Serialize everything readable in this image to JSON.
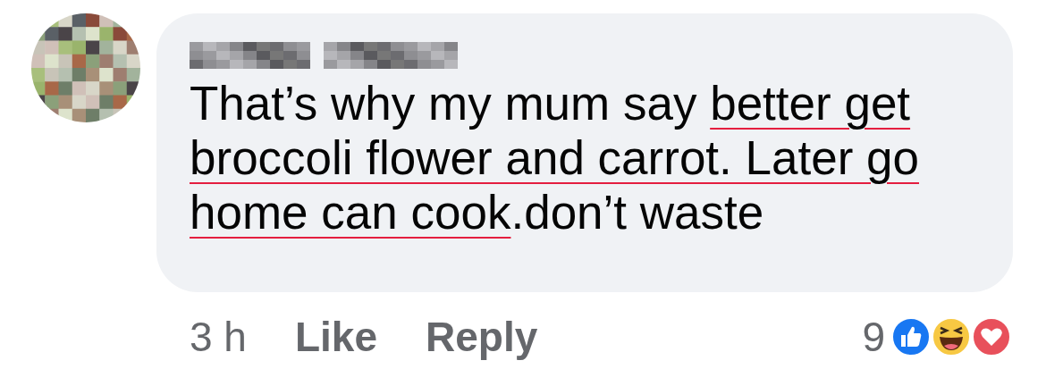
{
  "comment": {
    "text_segments": [
      {
        "text": "That’s why my mum say ",
        "underlined": false
      },
      {
        "text": "better get broccoli flower and carrot. Later go home can cook",
        "underlined": true
      },
      {
        "text": ".don’t waste",
        "underlined": false
      }
    ]
  },
  "footer": {
    "time": "3 h",
    "actions": [
      "Like",
      "Reply"
    ],
    "reaction_count": "9"
  }
}
